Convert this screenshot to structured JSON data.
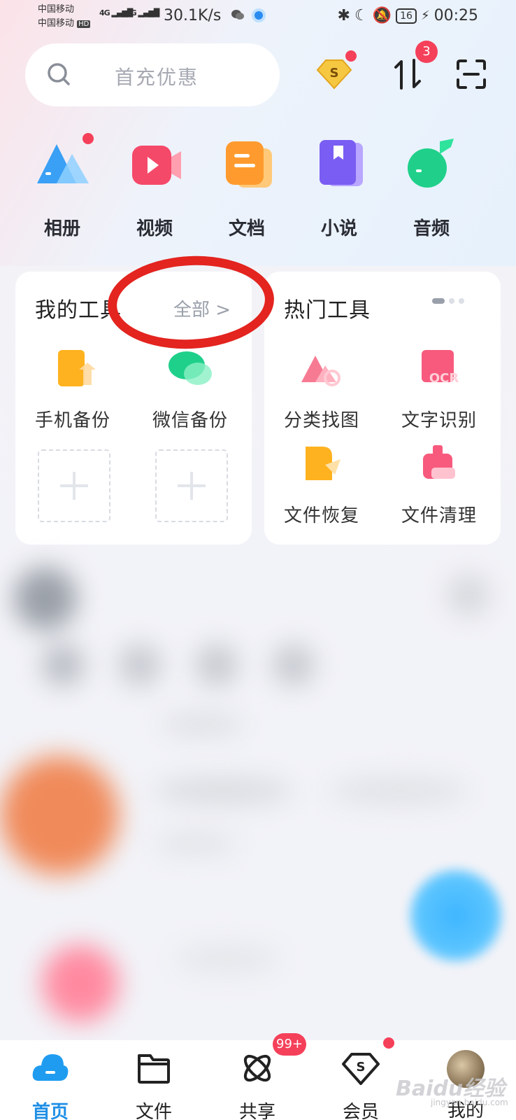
{
  "status_bar": {
    "carrier1": "中国移动",
    "carrier2": "中国移动",
    "hd": "HD",
    "net1": "4G",
    "net2": "4G",
    "speed": "30.1K/s",
    "battery": "16",
    "time": "00:25"
  },
  "search": {
    "placeholder": "首充优惠"
  },
  "header": {
    "transfer_badge": "3"
  },
  "categories": [
    {
      "label": "相册",
      "icon": "album-icon"
    },
    {
      "label": "视频",
      "icon": "video-icon"
    },
    {
      "label": "文档",
      "icon": "document-icon"
    },
    {
      "label": "小说",
      "icon": "novel-icon"
    },
    {
      "label": "音频",
      "icon": "audio-icon"
    }
  ],
  "my_tools": {
    "title": "我的工具",
    "all_label": "全部 >",
    "items": [
      {
        "label": "手机备份",
        "icon": "phone-backup-icon"
      },
      {
        "label": "微信备份",
        "icon": "wechat-backup-icon"
      }
    ]
  },
  "hot_tools": {
    "title": "热门工具",
    "items": [
      {
        "label": "分类找图",
        "icon": "image-search-icon"
      },
      {
        "label": "文字识别",
        "icon": "ocr-icon"
      },
      {
        "label": "文件恢复",
        "icon": "file-recover-icon"
      },
      {
        "label": "文件清理",
        "icon": "file-clean-icon"
      }
    ],
    "ocr_text": "OCR"
  },
  "bottom_nav": {
    "items": [
      {
        "label": "首页",
        "icon": "cloud-home-icon",
        "active": true
      },
      {
        "label": "文件",
        "icon": "folder-icon"
      },
      {
        "label": "共享",
        "icon": "share-atom-icon",
        "badge": "99+"
      },
      {
        "label": "会员",
        "icon": "vip-diamond-icon"
      },
      {
        "label": "我的",
        "icon": "avatar"
      }
    ]
  },
  "watermark": {
    "text": "Baidu经验",
    "sub": "jingyan.baidu.com"
  },
  "colors": {
    "accent": "#1f8fe6",
    "badge": "#f5405a",
    "annotation": "#e3241f"
  }
}
